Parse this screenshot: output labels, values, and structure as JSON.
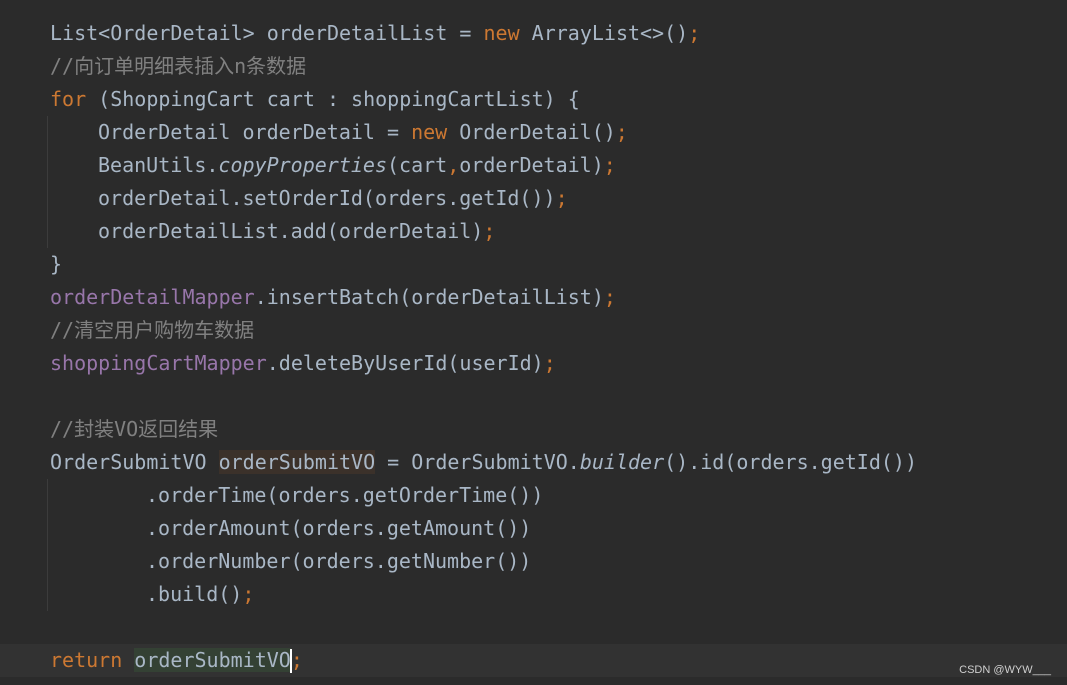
{
  "code": {
    "l1": {
      "a": "List<OrderDetail> orderDetailList = ",
      "kw": "new",
      "b": " ArrayList<>()",
      "semi": ";"
    },
    "l2": {
      "comment": "//向订单明细表插入n条数据"
    },
    "l3": {
      "kw": "for",
      "b": " (ShoppingCart cart : shoppingCartList) {"
    },
    "l4": {
      "a": "OrderDetail orderDetail = ",
      "kw": "new",
      "b": " OrderDetail()",
      "semi": ";"
    },
    "l5": {
      "a": "BeanUtils.",
      "it": "copyProperties",
      "b": "(cart",
      "comma": ",",
      "c": "orderDetail)",
      "semi": ";"
    },
    "l6": {
      "a": "orderDetail.setOrderId(orders.getId())",
      "semi": ";"
    },
    "l7": {
      "a": "orderDetailList.add(orderDetail)",
      "semi": ";"
    },
    "l8": {
      "a": "}"
    },
    "l9": {
      "fld": "orderDetailMapper",
      "b": ".insertBatch(orderDetailList)",
      "semi": ";"
    },
    "l10": {
      "comment": "//清空用户购物车数据"
    },
    "l11": {
      "fld": "shoppingCartMapper",
      "b": ".deleteByUserId(userId)",
      "semi": ";"
    },
    "l12": {
      "comment": "//封装VO返回结果"
    },
    "l13": {
      "a": "OrderSubmitVO ",
      "var": "orderSubmitVO",
      "b": " = OrderSubmitVO.",
      "it": "builder",
      "c": "().id(orders.getId())"
    },
    "l14": {
      "a": ".orderTime(orders.getOrderTime())"
    },
    "l15": {
      "a": ".orderAmount(orders.getAmount())"
    },
    "l16": {
      "a": ".orderNumber(orders.getNumber())"
    },
    "l17": {
      "a": ".build()",
      "semi": ";"
    },
    "l18": {
      "kw": "return",
      "sp": " ",
      "var": "orderSubmitVO",
      "semi": ";"
    }
  },
  "watermark": "CSDN @WYW___",
  "colors": {
    "background": "#2b2b2b",
    "text": "#a9b7c6",
    "keyword": "#cc7832",
    "comment": "#808080",
    "field": "#9876aa"
  }
}
